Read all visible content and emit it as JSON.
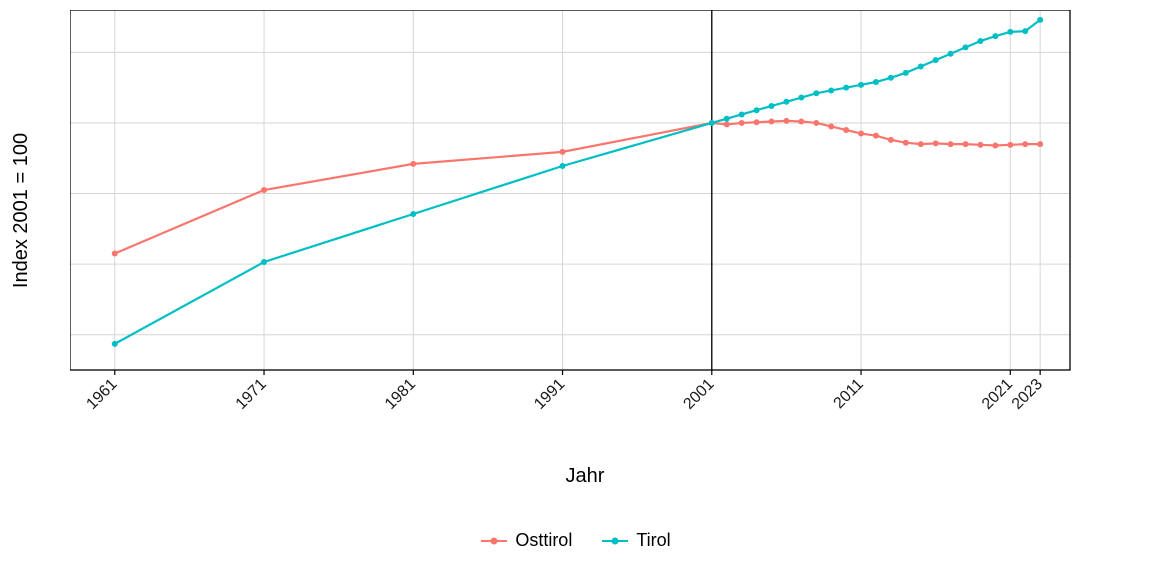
{
  "chart_data": {
    "type": "line",
    "xlabel": "Jahr",
    "ylabel": "Index 2001 = 100",
    "title": "",
    "ylim": [
      65,
      116
    ],
    "xlim": [
      1958,
      2025
    ],
    "reference_x": 2001,
    "x_ticks": [
      1961,
      1971,
      1981,
      1991,
      2001,
      2011,
      2021,
      2023
    ],
    "y_ticks": [
      70,
      80,
      90,
      100,
      110
    ],
    "legend_position": "bottom",
    "colors": {
      "Osttirol": "#f8766d",
      "Tirol": "#00bfc4"
    },
    "series": [
      {
        "name": "Osttirol",
        "x": [
          1961,
          1971,
          1981,
          1991,
          2001,
          2002,
          2003,
          2004,
          2005,
          2006,
          2007,
          2008,
          2009,
          2010,
          2011,
          2012,
          2013,
          2014,
          2015,
          2016,
          2017,
          2018,
          2019,
          2020,
          2021,
          2022,
          2023
        ],
        "values": [
          81.5,
          90.5,
          94.2,
          95.9,
          100.0,
          99.8,
          100.0,
          100.1,
          100.2,
          100.3,
          100.2,
          100.0,
          99.5,
          99.0,
          98.5,
          98.2,
          97.6,
          97.2,
          97.0,
          97.1,
          97.0,
          97.0,
          96.9,
          96.8,
          96.9,
          97.0,
          97.0
        ]
      },
      {
        "name": "Tirol",
        "x": [
          1961,
          1971,
          1981,
          1991,
          2001,
          2002,
          2003,
          2004,
          2005,
          2006,
          2007,
          2008,
          2009,
          2010,
          2011,
          2012,
          2013,
          2014,
          2015,
          2016,
          2017,
          2018,
          2019,
          2020,
          2021,
          2022,
          2023
        ],
        "values": [
          68.7,
          80.3,
          87.1,
          93.9,
          100.0,
          100.6,
          101.2,
          101.8,
          102.4,
          103.0,
          103.6,
          104.2,
          104.6,
          105.0,
          105.4,
          105.8,
          106.4,
          107.1,
          108.0,
          108.9,
          109.8,
          110.7,
          111.6,
          112.3,
          112.9,
          113.0,
          114.6
        ]
      }
    ]
  }
}
